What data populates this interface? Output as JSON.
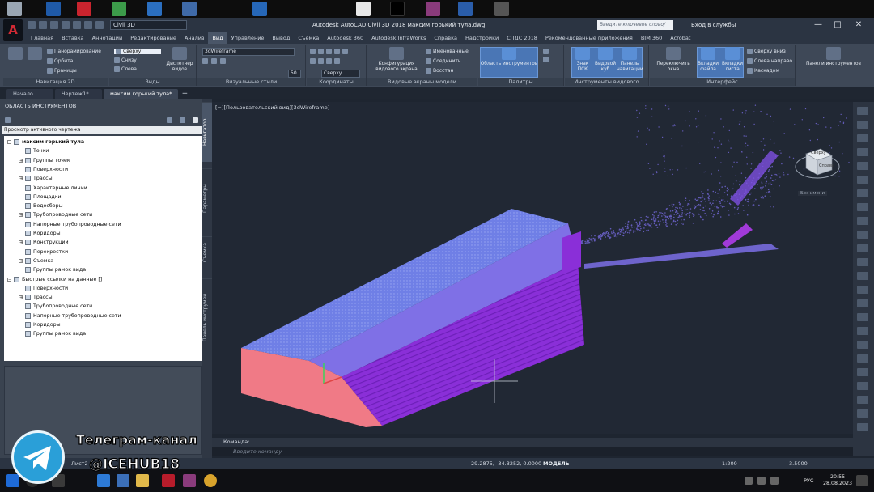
{
  "window": {
    "title": "Autodesk AutoCAD Civil 3D 2018    максим горький тула.dwg",
    "workspace": "Civil 3D",
    "search_placeholder": "Введите ключевое слово/фразу",
    "signin": "Вход в службы",
    "controls": [
      "—",
      "□",
      "✕"
    ]
  },
  "ribbon_tabs": [
    {
      "label": "Главная",
      "active": false
    },
    {
      "label": "Вставка",
      "active": false
    },
    {
      "label": "Аннотации",
      "active": false
    },
    {
      "label": "Редактирование",
      "active": false
    },
    {
      "label": "Анализ",
      "active": false
    },
    {
      "label": "Вид",
      "active": true
    },
    {
      "label": "Управление",
      "active": false
    },
    {
      "label": "Вывод",
      "active": false
    },
    {
      "label": "Съемка",
      "active": false
    },
    {
      "label": "Autodesk 360",
      "active": false
    },
    {
      "label": "Autodesk InfraWorks",
      "active": false
    },
    {
      "label": "Справка",
      "active": false
    },
    {
      "label": "Надстройки",
      "active": false
    },
    {
      "label": "СПДС 2018",
      "active": false
    },
    {
      "label": "Рекомендованные приложения",
      "active": false
    },
    {
      "label": "BIM 360",
      "active": false
    },
    {
      "label": "Acrobat",
      "active": false
    }
  ],
  "ribbon": {
    "nav2d": {
      "title": "Навигация 2D",
      "pan": "Панорамирование",
      "orbit": "Орбита",
      "extents": "Границы"
    },
    "views": {
      "title": "Виды",
      "items": [
        "Сверху",
        "Снизу",
        "Слева"
      ],
      "manager": "Диспетчер видов"
    },
    "visual_styles": {
      "title": "Визуальные стили",
      "current": "3dWireframe",
      "opacity": "50"
    },
    "coordinates": {
      "title": "Координаты",
      "ucs_view": "Сверху"
    },
    "model_viewports": {
      "title": "Видовые экраны модели",
      "config": "Конфигурация видового экрана",
      "named": "Именованные",
      "join": "Соединить",
      "restore": "Восстан"
    },
    "palettes": {
      "title": "Палитры",
      "toolspace": "Область инструментов"
    },
    "viewport_tools": {
      "title": "Инструменты видового экрана",
      "ucs_icon": "Знак ПСК",
      "viewcube": "Видовой куб",
      "navbar": "Панель навигации"
    },
    "interface": {
      "title": "Интерфейс",
      "switch_windows": "Переключить окна",
      "file_tabs": "Вкладки файла",
      "layout_tabs": "Вкладки листа",
      "tile_vert": "Сверху вниз",
      "tile_horz": "Слева направо",
      "cascade": "Каскадом"
    },
    "toolbars": "Панели инструментов"
  },
  "doc_tabs": [
    {
      "label": "Начало",
      "active": false
    },
    {
      "label": "Чертеж1*",
      "active": false
    },
    {
      "label": "максим горький тула*",
      "active": true
    }
  ],
  "toolspace": {
    "title": "ОБЛАСТЬ ИНСТРУМЕНТОВ",
    "view_combo": "Просмотр активного чертежа",
    "side_tabs": [
      "Навигатор",
      "Параметры",
      "Съемка",
      "Панель инструмен..."
    ],
    "tree": [
      {
        "label": "максим горький тула",
        "level": 0,
        "bold": true,
        "expander": "−"
      },
      {
        "label": "Точки",
        "level": 1,
        "expander": ""
      },
      {
        "label": "Группы точек",
        "level": 1,
        "expander": "+"
      },
      {
        "label": "Поверхности",
        "level": 1,
        "expander": ""
      },
      {
        "label": "Трассы",
        "level": 1,
        "expander": "+"
      },
      {
        "label": "Характерные линии",
        "level": 1,
        "expander": ""
      },
      {
        "label": "Площадки",
        "level": 1,
        "expander": ""
      },
      {
        "label": "Водосборы",
        "level": 1,
        "expander": ""
      },
      {
        "label": "Трубопроводные сети",
        "level": 1,
        "expander": "+"
      },
      {
        "label": "Напорные трубопроводные сети",
        "level": 1,
        "expander": ""
      },
      {
        "label": "Коридоры",
        "level": 1,
        "expander": ""
      },
      {
        "label": "Конструкции",
        "level": 1,
        "expander": "+"
      },
      {
        "label": "Перекрестки",
        "level": 1,
        "expander": ""
      },
      {
        "label": "Съемка",
        "level": 1,
        "expander": "+"
      },
      {
        "label": "Группы рамок вида",
        "level": 1,
        "expander": ""
      },
      {
        "label": "Быстрые ссылки на данные []",
        "level": 0,
        "bold": false,
        "expander": "−"
      },
      {
        "label": "Поверхности",
        "level": 1,
        "expander": ""
      },
      {
        "label": "Трассы",
        "level": 1,
        "expander": "+"
      },
      {
        "label": "Трубопроводные сети",
        "level": 1,
        "expander": ""
      },
      {
        "label": "Напорные трубопроводные сети",
        "level": 1,
        "expander": ""
      },
      {
        "label": "Коридоры",
        "level": 1,
        "expander": ""
      },
      {
        "label": "Группы рамок вида",
        "level": 1,
        "expander": ""
      }
    ]
  },
  "viewport": {
    "label": "[−][Пользовательский вид][3dWireframe]",
    "viewcube_faces": [
      "Сверху",
      "Справа"
    ],
    "wcs": "Без имени"
  },
  "command": {
    "history": "Команда:",
    "prompt": "Введите команду"
  },
  "status": {
    "coords": "29.2875, -34.3252, 0.0000",
    "space": "МОДЕЛЬ",
    "scale": "1:200",
    "zoom": "3.5000"
  },
  "layout_tab": "Лист2",
  "taskbar": {
    "lang": "РУС",
    "time": "20:55",
    "date": "28.08.2023"
  },
  "overlay": {
    "line1": "Телеграм-канал",
    "line2": "@ICEHUB18"
  },
  "colors": {
    "accent": "#4a76b5",
    "model_top": "#6f82e8",
    "model_side": "#8a2fd8",
    "model_end": "#f07a86",
    "pointcloud": "#7b6ee8",
    "telegram": "#2a9fd8"
  }
}
